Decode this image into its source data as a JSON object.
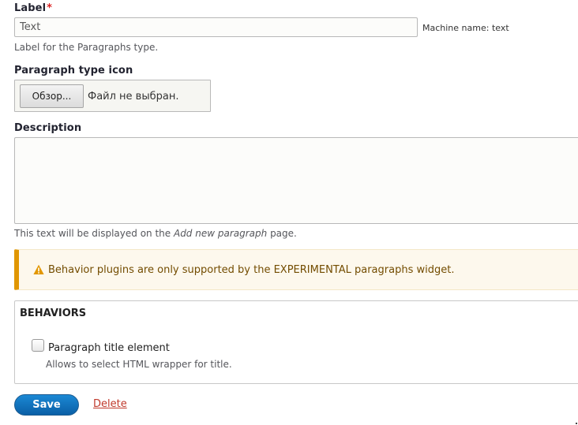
{
  "label_field": {
    "label": "Label",
    "required_marker": "*",
    "value": "Text",
    "machine_name": "Machine name: text",
    "description": "Label for the Paragraphs type."
  },
  "icon_field": {
    "label": "Paragraph type icon",
    "browse_button": "Обзор...",
    "file_status": "Файл не выбран."
  },
  "description_field": {
    "label": "Description",
    "value": "",
    "help_prefix": "This text will be displayed on the ",
    "help_emphasis": "Add new paragraph",
    "help_suffix": " page."
  },
  "warning": {
    "text": "Behavior plugins are only supported by the EXPERIMENTAL paragraphs widget.",
    "icon": "warning-triangle-icon"
  },
  "behaviors": {
    "legend": "BEHAVIORS",
    "option_label": "Paragraph title element",
    "option_checked": false,
    "option_description": "Allows to select HTML wrapper for title."
  },
  "actions": {
    "save_label": "Save",
    "delete_label": "Delete"
  },
  "colors": {
    "primary": "#0a5fa6",
    "warning_accent": "#e09600",
    "warning_text": "#734c00",
    "required": "#dc2323",
    "delete_link": "#c0392b"
  }
}
